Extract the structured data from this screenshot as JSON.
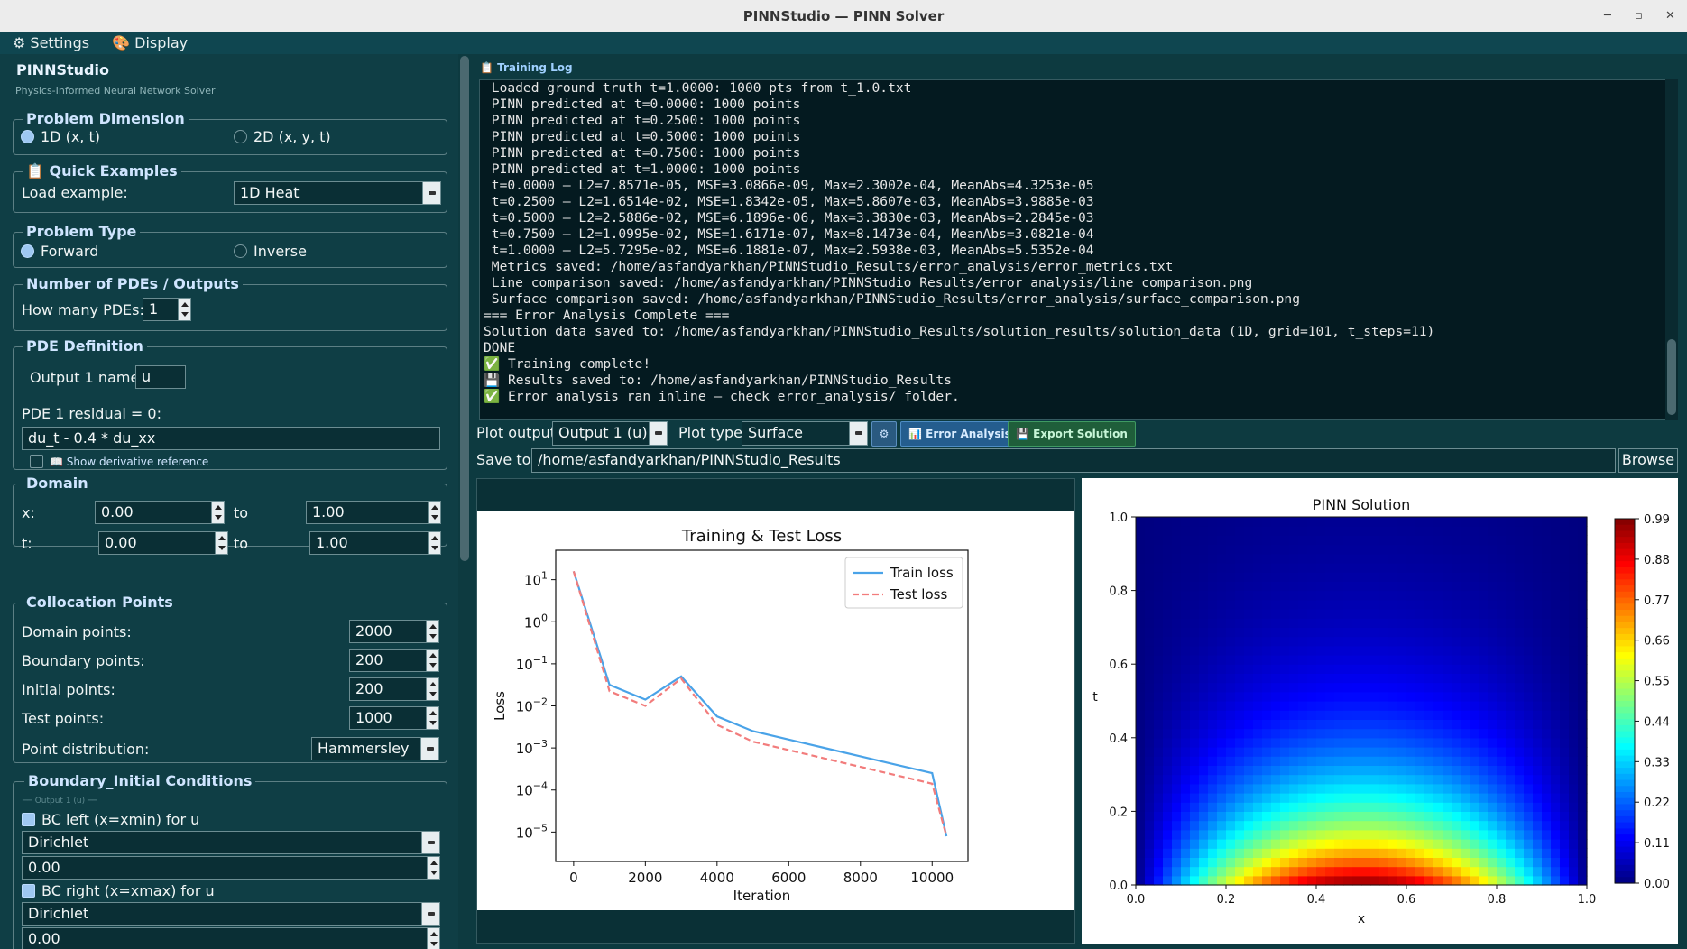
{
  "window": {
    "title": "PINNStudio — PINN Solver"
  },
  "menu": {
    "settings": "⚙ Settings",
    "display": "🎨 Display"
  },
  "sidebar": {
    "app_title": "PINNStudio",
    "app_subtitle": "Physics-Informed Neural Network Solver",
    "dimension": {
      "title": "Problem Dimension",
      "opt1": "1D  (x, t)",
      "opt2": "2D  (x, y, t)",
      "selected": "1D  (x, t)"
    },
    "examples": {
      "title": "📋 Quick Examples",
      "label": "Load example:",
      "value": "1D Heat"
    },
    "ptype": {
      "title": "Problem Type",
      "opt1": "Forward",
      "opt2": "Inverse",
      "selected": "Forward"
    },
    "npde": {
      "title": "Number of PDEs / Outputs",
      "label": "How many PDEs:",
      "value": "1"
    },
    "pde": {
      "title": "PDE Definition",
      "out_label": "Output 1 name:",
      "out_value": "u",
      "res_label": "PDE 1 residual = 0:",
      "res_value": "du_t - 0.4 * du_xx",
      "deriv_label": "📖 Show derivative reference"
    },
    "domain": {
      "title": "Domain",
      "x_label": "x:",
      "x_min": "0.00",
      "x_to": "to",
      "x_max": "1.00",
      "t_label": "t:",
      "t_min": "0.00",
      "t_to": "to",
      "t_max": "1.00"
    },
    "colloc": {
      "title": "Collocation Points",
      "domain_label": "Domain points:",
      "domain_value": "2000",
      "boundary_label": "Boundary points:",
      "boundary_value": "200",
      "initial_label": "Initial points:",
      "initial_value": "200",
      "test_label": "Test points:",
      "test_value": "1000",
      "dist_label": "Point distribution:",
      "dist_value": "Hammersley"
    },
    "bc": {
      "title": "Boundary_Initial Conditions",
      "sub": "── Output 1 (u) ──",
      "left_label": "BC left (x=xmin) for u",
      "left_type": "Dirichlet",
      "left_value": "0.00",
      "right_label": "BC right (x=xmax) for u",
      "right_type": "Dirichlet",
      "right_value": "0.00"
    }
  },
  "log": {
    "caption": "📋 Training Log",
    "lines": [
      " Loaded ground truth t=1.0000: 1000 pts from t_1.0.txt",
      " PINN predicted at t=0.0000: 1000 points",
      " PINN predicted at t=0.2500: 1000 points",
      " PINN predicted at t=0.5000: 1000 points",
      " PINN predicted at t=0.7500: 1000 points",
      " PINN predicted at t=1.0000: 1000 points",
      " t=0.0000 — L2=7.8571e-05, MSE=3.0866e-09, Max=2.3002e-04, MeanAbs=4.3253e-05",
      " t=0.2500 — L2=1.6514e-02, MSE=1.8342e-05, Max=5.8607e-03, MeanAbs=3.9885e-03",
      " t=0.5000 — L2=2.5886e-02, MSE=6.1896e-06, Max=3.3830e-03, MeanAbs=2.2845e-03",
      " t=0.7500 — L2=1.0995e-02, MSE=1.6171e-07, Max=8.1473e-04, MeanAbs=3.0821e-04",
      " t=1.0000 — L2=5.7295e-02, MSE=6.1881e-07, Max=2.5938e-03, MeanAbs=5.5352e-04",
      " Metrics saved: /home/asfandyarkhan/PINNStudio_Results/error_analysis/error_metrics.txt",
      " Line comparison saved: /home/asfandyarkhan/PINNStudio_Results/error_analysis/line_comparison.png",
      " Surface comparison saved: /home/asfandyarkhan/PINNStudio_Results/error_analysis/surface_comparison.png",
      "=== Error Analysis Complete ===",
      "Solution data saved to: /home/asfandyarkhan/PINNStudio_Results/solution_results/solution_data (1D, grid=101, t_steps=11)",
      "DONE",
      "",
      "✅ Training complete!",
      "💾 Results saved to: /home/asfandyarkhan/PINNStudio_Results",
      "✅ Error analysis ran inline — check error_analysis/ folder."
    ]
  },
  "toolbar": {
    "plot_output_label": "Plot output:",
    "plot_output_value": "Output 1 (u)",
    "plot_type_label": "Plot type:",
    "plot_type_value": "Surface",
    "error_btn": "📊 Error Analysis",
    "export_btn": "💾 Export Solution",
    "save_label": "Save to:",
    "save_value": "/home/asfandyarkhan/PINNStudio_Results",
    "browse": "Browse"
  },
  "colors": {
    "accent": "#2a6fa8",
    "export_green": "#1f5e3a",
    "train": "#4aa3e8",
    "test": "#f27c7c"
  },
  "chart_data": [
    {
      "type": "line",
      "title": "Training & Test Loss",
      "xlabel": "Iteration",
      "ylabel": "Loss",
      "yscale": "log",
      "xlim": [
        -500,
        11000
      ],
      "ylim_log10": [
        -5.7,
        1.7
      ],
      "xticks": [
        0,
        2000,
        4000,
        6000,
        8000,
        10000
      ],
      "yticks": [
        "10^1",
        "10^0",
        "10^-1",
        "10^-2",
        "10^-3",
        "10^-4",
        "10^-5"
      ],
      "legend_position": "top-right",
      "series": [
        {
          "name": "Train loss",
          "style": "solid",
          "x": [
            0,
            1000,
            2000,
            3000,
            4000,
            5000,
            6000,
            7000,
            8000,
            9000,
            10000,
            10400
          ],
          "log10_y": [
            1.2,
            -1.5,
            -1.85,
            -1.3,
            -2.25,
            -2.6,
            -2.8,
            -3.0,
            -3.2,
            -3.4,
            -3.6,
            -5.1
          ]
        },
        {
          "name": "Test loss",
          "style": "dashed",
          "x": [
            0,
            1000,
            2000,
            3000,
            4000,
            5000,
            6000,
            7000,
            8000,
            9000,
            10000,
            10400
          ],
          "log10_y": [
            1.2,
            -1.65,
            -2.0,
            -1.35,
            -2.45,
            -2.85,
            -3.05,
            -3.25,
            -3.45,
            -3.65,
            -3.85,
            -5.1
          ]
        }
      ]
    },
    {
      "type": "heatmap",
      "title": "PINN Solution",
      "xlabel": "x",
      "ylabel": "t",
      "xlim": [
        0,
        1
      ],
      "ylim": [
        0,
        1
      ],
      "xticks": [
        "0.0",
        "0.2",
        "0.4",
        "0.6",
        "0.8",
        "1.0"
      ],
      "yticks": [
        "0.0",
        "0.2",
        "0.4",
        "0.6",
        "0.8",
        "1.0"
      ],
      "colorbar_ticks": [
        "0.99",
        "0.88",
        "0.77",
        "0.66",
        "0.55",
        "0.44",
        "0.33",
        "0.22",
        "0.11",
        "0.00"
      ],
      "function": "sin(pi*x)*exp(-0.4*pi^2*t)"
    }
  ]
}
